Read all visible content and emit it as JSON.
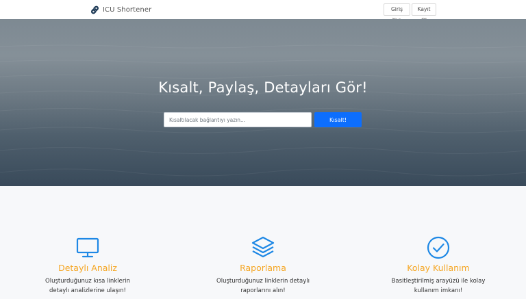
{
  "navbar": {
    "brand": "ICU Shortener",
    "brand_icon": "link-icon",
    "login_label": "Giriş Yap",
    "register_label": "Kayıt Ol"
  },
  "hero": {
    "title": "Kısalt, Paylaş, Detayları Gör!",
    "input_placeholder": "Kısaltılacak bağlantıyı yazın...",
    "input_value": "",
    "button_label": "Kısalt!",
    "button_color": "#0d6efd"
  },
  "features": {
    "title_color": "#f5a623",
    "icon_color": "#1e88e5",
    "items": [
      {
        "icon": "monitor-icon",
        "title": "Detaylı Analiz",
        "desc_line1": "Oluşturduğunuz kısa linklerin",
        "desc_line2": "detaylı analizlerine ulaşın!"
      },
      {
        "icon": "layers-icon",
        "title": "Raporlama",
        "desc_line1": "Oluşturduğunuz linklerin detaylı",
        "desc_line2": "raporlarını alın!"
      },
      {
        "icon": "check-circle-icon",
        "title": "Kolay Kullanım",
        "desc_line1": "Basitleştirilmiş arayüzü ile kolay",
        "desc_line2": "kullanım imkanı!"
      }
    ]
  }
}
